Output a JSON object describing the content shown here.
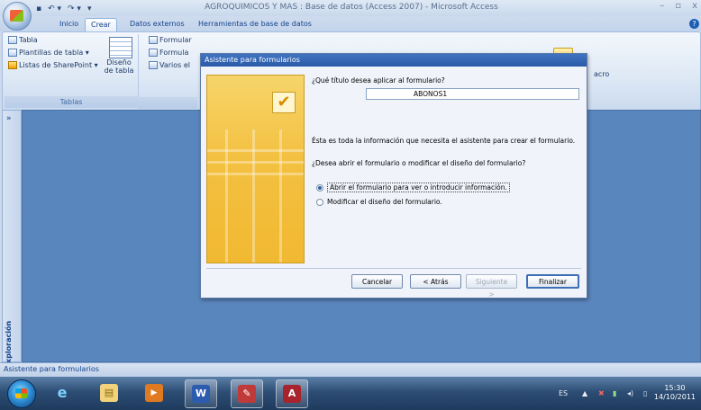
{
  "window": {
    "title": "AGROQUIMICOS Y MAS : Base de datos (Access 2007) - Microsoft Access",
    "controls": [
      "–",
      "▫",
      "x"
    ]
  },
  "quick_access": [
    "▪",
    "↶ ▾",
    "↷ ▾",
    "▾"
  ],
  "ribbon": {
    "tabs": [
      {
        "label": "Inicio"
      },
      {
        "label": "Crear"
      },
      {
        "label": "Datos externos"
      },
      {
        "label": "Herramientas de base de datos"
      }
    ],
    "active_tab": "Crear",
    "help_icon": "?",
    "tablas_group": {
      "label": "Tablas",
      "items": [
        "Tabla",
        "Plantillas de tabla ▾",
        "Listas de SharePoint ▾"
      ],
      "big_button": "Diseño de tabla"
    },
    "formularios_group": {
      "items": [
        "Formular",
        "Formula",
        "Varios el"
      ]
    },
    "macro_fragment": "acro"
  },
  "nav_pane": {
    "toggle": "»",
    "label": "Panel de exploración"
  },
  "dialog": {
    "title": "Asistente para formularios",
    "question_title": "¿Qué título desea aplicar al formulario?",
    "form_title_value": "ABONOS1",
    "info_text": "Ésta es toda la información que necesita el asistente para crear el formulario.",
    "question_open": "¿Desea abrir el formulario o modificar el diseño del formulario?",
    "options": [
      {
        "label": "Abrir el formulario para ver o introducir información.",
        "selected": true
      },
      {
        "label": "Modificar el diseño del formulario.",
        "selected": false
      }
    ],
    "buttons": {
      "cancel": "Cancelar",
      "back": "< Atrás",
      "next": "Siguiente >",
      "finish": "Finalizar"
    }
  },
  "status_bar": {
    "text": "Asistente para formularios"
  },
  "taskbar": {
    "apps": [
      {
        "name": "internet-explorer",
        "glyph": "e"
      },
      {
        "name": "file-explorer",
        "glyph": "▤"
      },
      {
        "name": "media-player",
        "glyph": "▶"
      },
      {
        "name": "word",
        "glyph": "W"
      },
      {
        "name": "paint",
        "glyph": "✎"
      },
      {
        "name": "access",
        "glyph": "A"
      }
    ],
    "language": "ES",
    "time": "15:30",
    "date": "14/10/2011"
  },
  "colors": {
    "workspace": "#5a86be",
    "dialog_title": "#2a5aa8",
    "wizard_image": "#f3c040"
  }
}
